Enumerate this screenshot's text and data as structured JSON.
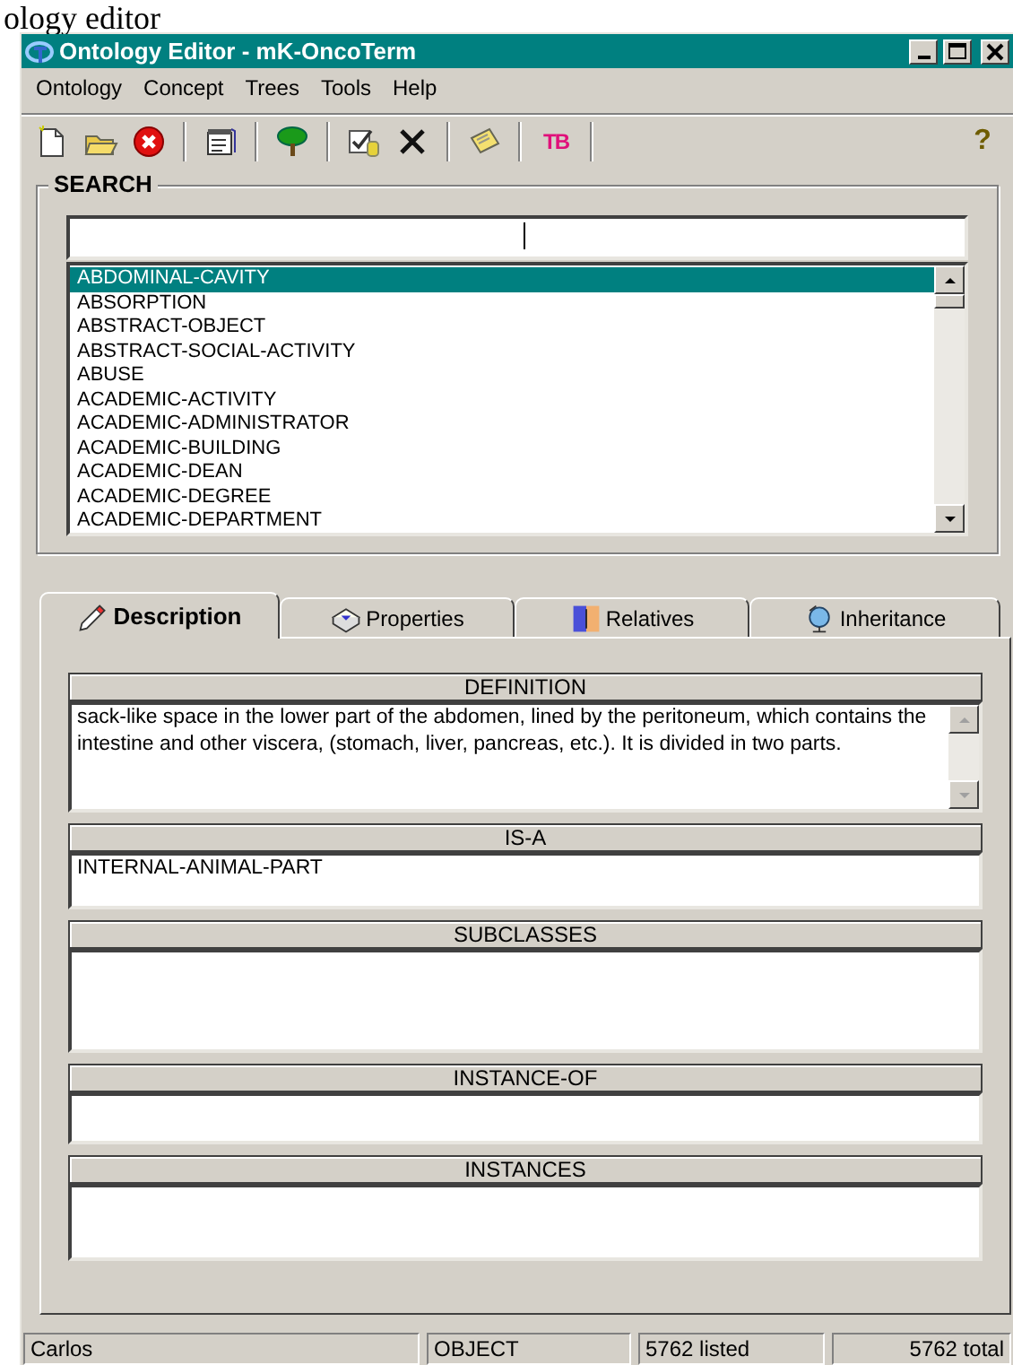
{
  "caption": "ology editor",
  "window": {
    "title": "Ontology Editor - mK-OncoTerm"
  },
  "menu": [
    "Ontology",
    "Concept",
    "Trees",
    "Tools",
    "Help"
  ],
  "toolbar": [
    {
      "kind": "new"
    },
    {
      "kind": "open"
    },
    {
      "kind": "delete"
    },
    {
      "kind": "separator"
    },
    {
      "kind": "properties"
    },
    {
      "kind": "separator"
    },
    {
      "kind": "tree"
    },
    {
      "kind": "separator"
    },
    {
      "kind": "check"
    },
    {
      "kind": "cross"
    },
    {
      "kind": "separator"
    },
    {
      "kind": "note"
    },
    {
      "kind": "separator"
    },
    {
      "kind": "text",
      "label": "TB"
    },
    {
      "kind": "separator"
    },
    {
      "kind": "help",
      "label": "?"
    }
  ],
  "search": {
    "title": "SEARCH",
    "items": [
      {
        "label": "ABDOMINAL-CAVITY",
        "selected": true
      },
      {
        "label": "ABSORPTION",
        "selected": false
      },
      {
        "label": "ABSTRACT-OBJECT",
        "selected": false
      },
      {
        "label": "ABSTRACT-SOCIAL-ACTIVITY",
        "selected": false
      },
      {
        "label": "ABUSE",
        "selected": false
      },
      {
        "label": "ACADEMIC-ACTIVITY",
        "selected": false
      },
      {
        "label": "ACADEMIC-ADMINISTRATOR",
        "selected": false
      },
      {
        "label": "ACADEMIC-BUILDING",
        "selected": false
      },
      {
        "label": "ACADEMIC-DEAN",
        "selected": false
      },
      {
        "label": "ACADEMIC-DEGREE",
        "selected": false
      },
      {
        "label": "ACADEMIC-DEPARTMENT",
        "selected": false
      }
    ]
  },
  "tabs": [
    {
      "label": "Description",
      "selected": true,
      "kind": "pencil"
    },
    {
      "label": "Properties",
      "selected": false,
      "kind": "box"
    },
    {
      "label": "Relatives",
      "selected": false,
      "kind": "faces"
    },
    {
      "label": "Inheritance",
      "selected": false,
      "kind": "globe"
    }
  ],
  "sections": [
    {
      "heading": "DEFINITION",
      "kind": "scroll",
      "text": "sack-like space in the lower part of the abdomen, lined by the peritoneum, which contains the intestine and other viscera, (stomach, liver, pancreas, etc.). It is divided in two parts."
    },
    {
      "heading": "IS-A",
      "kind": "list",
      "text": "INTERNAL-ANIMAL-PART"
    },
    {
      "heading": "SUBCLASSES",
      "kind": "list"
    },
    {
      "heading": "INSTANCE-OF",
      "kind": "list"
    },
    {
      "heading": "INSTANCES",
      "kind": "list"
    }
  ],
  "status_bar": [
    "Carlos",
    "OBJECT",
    "5762 listed",
    "5762 total"
  ]
}
